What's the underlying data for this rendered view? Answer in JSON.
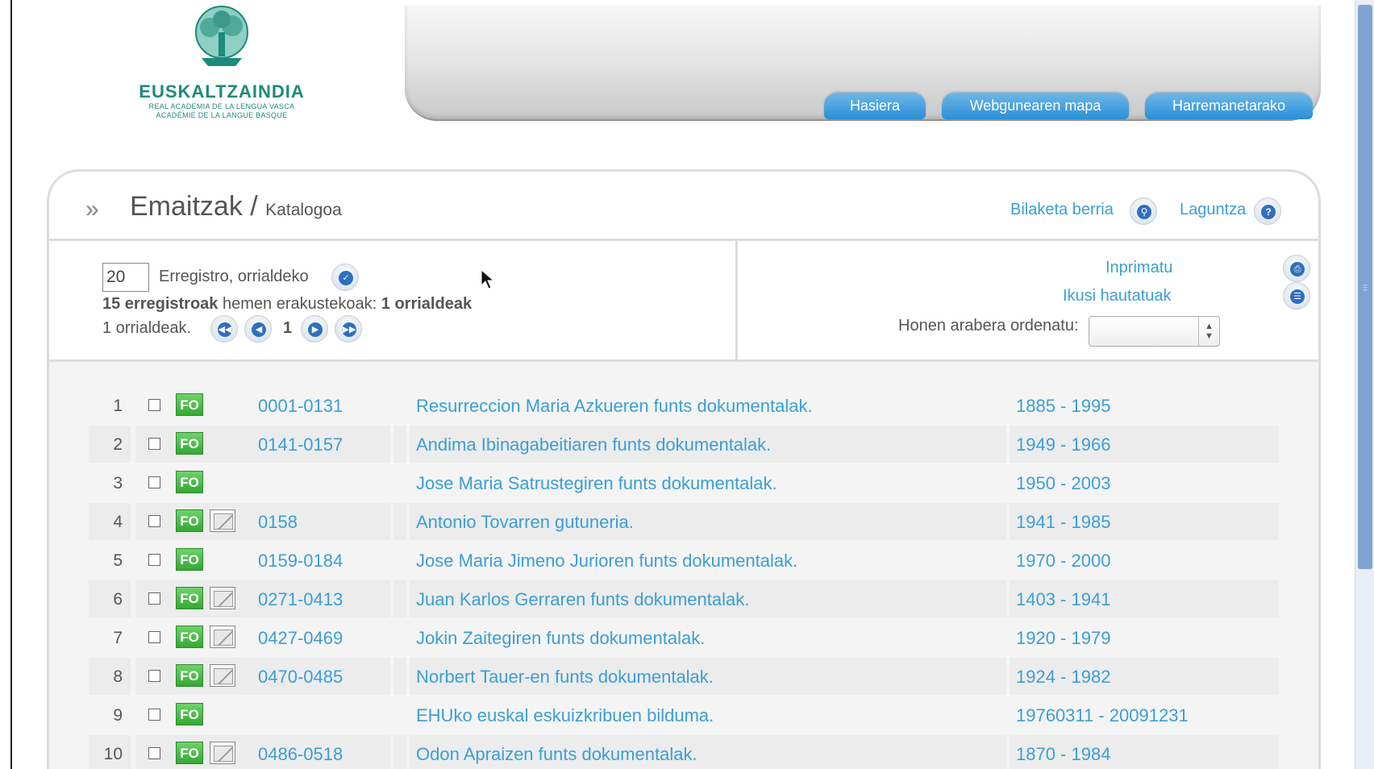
{
  "logo": {
    "name": "EUSKALTZAINDIA",
    "sub1": "REAL ACADEMIA DE LA LENGUA VASCA",
    "sub2": "ACADÉMIE DE LA LANGUE BASQUE"
  },
  "nav": {
    "tabs": [
      {
        "label": "Hasiera"
      },
      {
        "label": "Webgunearen mapa"
      },
      {
        "label": "Harremanetarako"
      }
    ]
  },
  "header": {
    "title": "Emaitzak /",
    "subtitle": "Katalogoa",
    "new_search": "Bilaketa berria",
    "help": "Laguntza"
  },
  "controls": {
    "per_page_value": "20",
    "per_page_label": "Erregistro, orrialdeko",
    "records_count": "15 erregistroak",
    "records_mid": "hemen erakustekoak:",
    "pages_count": "1 orrialdeak",
    "pages_label": "1 orrialdeak.",
    "current_page": "1",
    "print": "Inprimatu",
    "view_selected": "Ikusi hautatuak",
    "sort_label": "Honen arabera ordenatu:",
    "sort_value": ""
  },
  "results": [
    {
      "num": "1",
      "fo": "FO",
      "image": false,
      "code": "0001-0131",
      "title": "Resurreccion Maria Azkueren funts dokumentalak.",
      "dates": "1885 - 1995"
    },
    {
      "num": "2",
      "fo": "FO",
      "image": false,
      "code": "0141-0157",
      "title": "Andima Ibinagabeitiaren funts dokumentalak.",
      "dates": "1949 - 1966"
    },
    {
      "num": "3",
      "fo": "FO",
      "image": false,
      "code": "",
      "title": "Jose Maria Satrustegiren funts dokumentalak.",
      "dates": "1950 - 2003"
    },
    {
      "num": "4",
      "fo": "FO",
      "image": true,
      "code": "0158",
      "title": "Antonio Tovarren gutuneria.",
      "dates": "1941 - 1985"
    },
    {
      "num": "5",
      "fo": "FO",
      "image": false,
      "code": "0159-0184",
      "title": "Jose Maria Jimeno Jurioren funts dokumentalak.",
      "dates": "1970 - 2000"
    },
    {
      "num": "6",
      "fo": "FO",
      "image": true,
      "code": "0271-0413",
      "title": "Juan Karlos Gerraren funts dokumentalak.",
      "dates": "1403 - 1941"
    },
    {
      "num": "7",
      "fo": "FO",
      "image": true,
      "code": "0427-0469",
      "title": "Jokin Zaitegiren funts dokumentalak.",
      "dates": "1920 - 1979"
    },
    {
      "num": "8",
      "fo": "FO",
      "image": true,
      "code": "0470-0485",
      "title": "Norbert Tauer-en funts dokumentalak.",
      "dates": "1924 - 1982"
    },
    {
      "num": "9",
      "fo": "FO",
      "image": false,
      "code": "",
      "title": "EHUko euskal eskuizkribuen bilduma.",
      "dates": "19760311 - 20091231"
    },
    {
      "num": "10",
      "fo": "FO",
      "image": true,
      "code": "0486-0518",
      "title": "Odon Apraizen funts dokumentalak.",
      "dates": "1870 - 1984"
    }
  ]
}
